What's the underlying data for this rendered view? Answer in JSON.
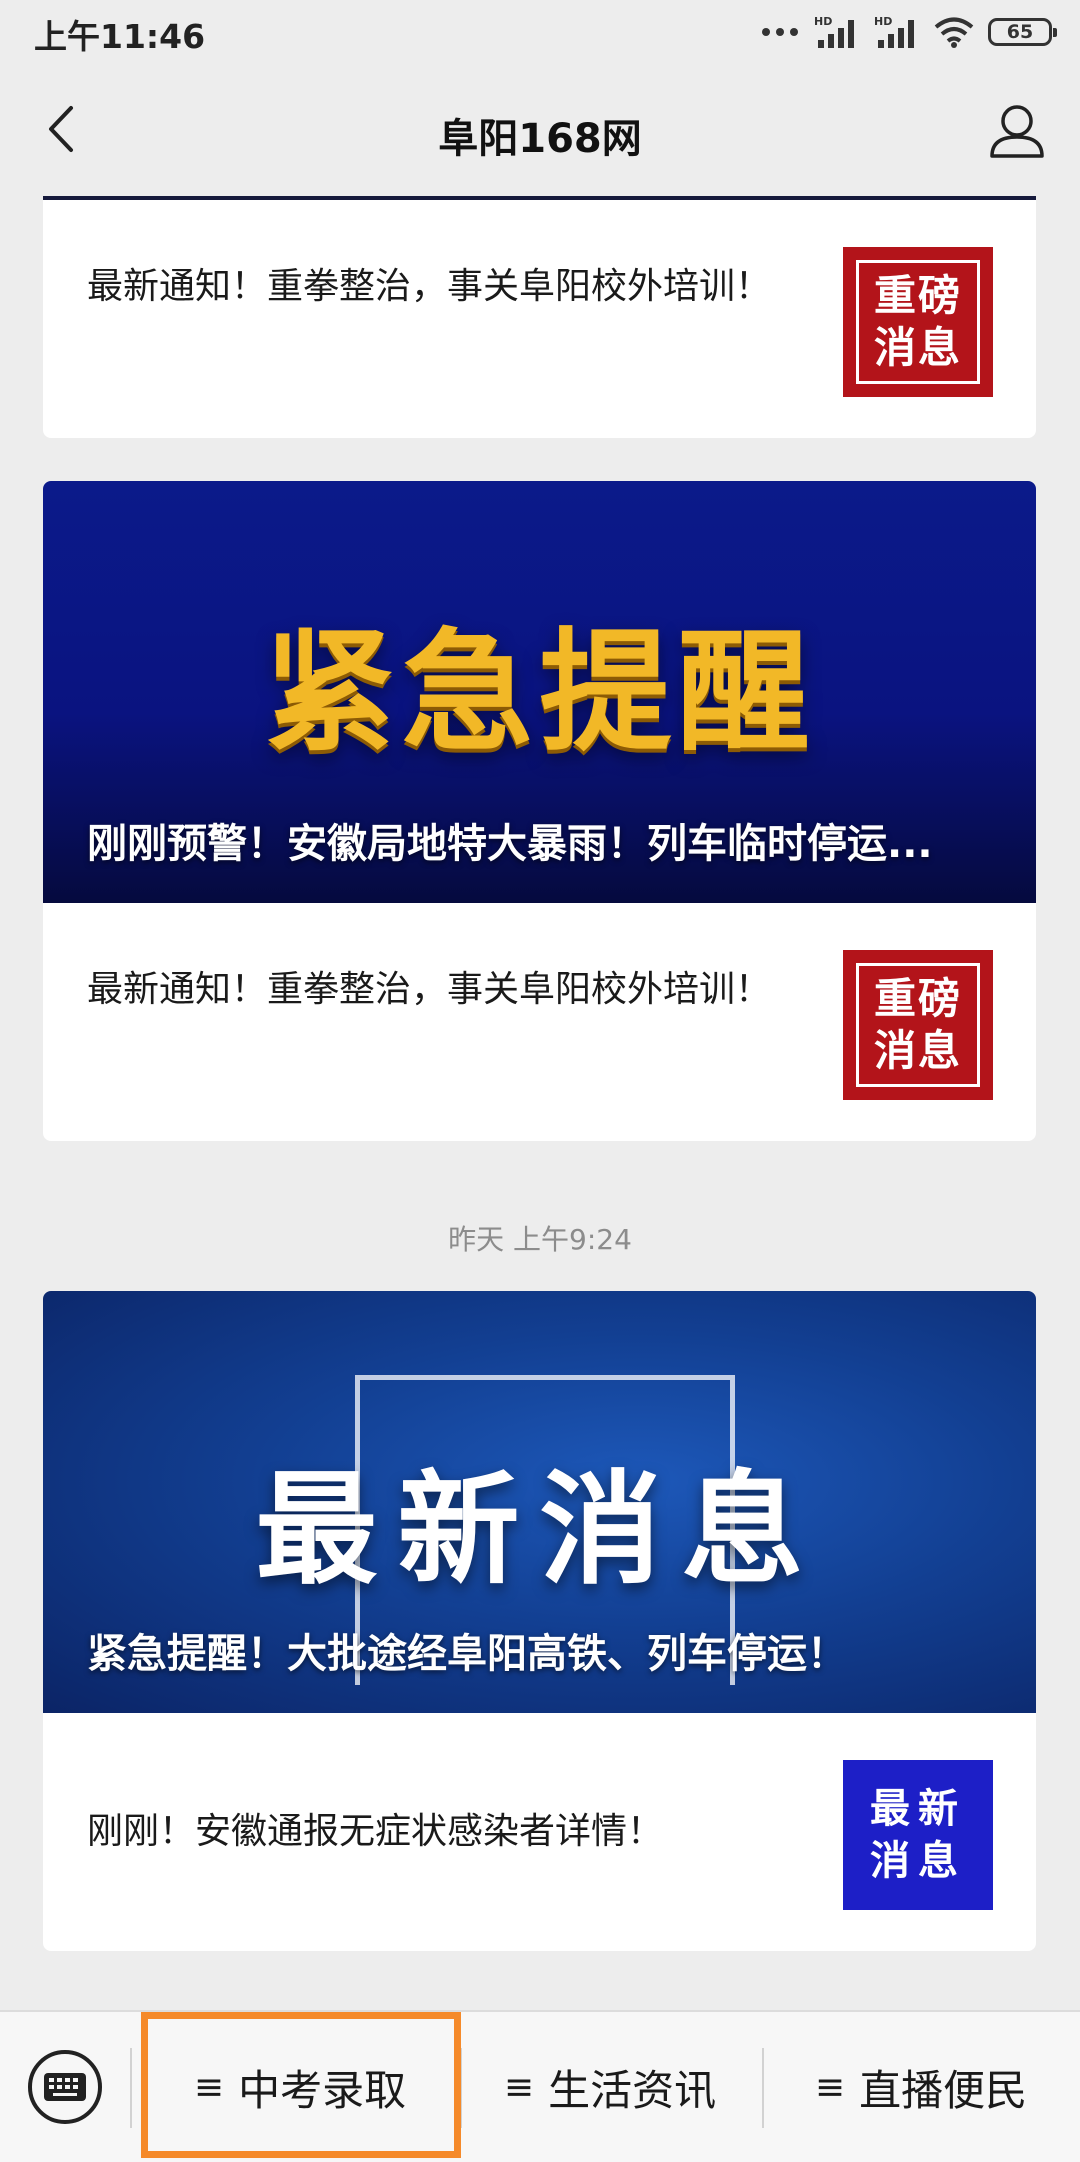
{
  "status_bar": {
    "time": "上午11:46",
    "battery": "65",
    "icons": [
      "more-dots-icon",
      "hd-signal-icon",
      "hd-signal-icon",
      "wifi-icon",
      "battery-icon"
    ]
  },
  "nav": {
    "title": "阜阳168网",
    "back_icon": "chevron-left-icon",
    "profile_icon": "user-icon"
  },
  "messages": [
    {
      "text": "最新通知！重拳整治，事关阜阳校外培训！",
      "thumb": "重磅消息"
    },
    {
      "banner_title": "紧急提醒",
      "caption": "刚刚预警！安徽局地特大暴雨！列车临时停运...",
      "text": "最新通知！重拳整治，事关阜阳校外培训！",
      "thumb": "重磅消息"
    },
    {
      "timestamp": "昨天 上午9:24",
      "banner_title": "最新消息",
      "caption": "紧急提醒！大批途经阜阳高铁、列车停运！",
      "text": "刚刚！安徽通报无症状感染者详情！",
      "thumb": "最新消息"
    }
  ],
  "bottom_menu": {
    "keyboard_icon": "keyboard-icon",
    "items": [
      "中考录取",
      "生活资讯",
      "直播便民"
    ],
    "menu_glyph": "≡",
    "highlight_color": "#f58a2a"
  },
  "colors": {
    "red_thumb": "#b3141a",
    "blue_thumb": "#1d1fc7",
    "banner_gold": "#f2b827"
  }
}
